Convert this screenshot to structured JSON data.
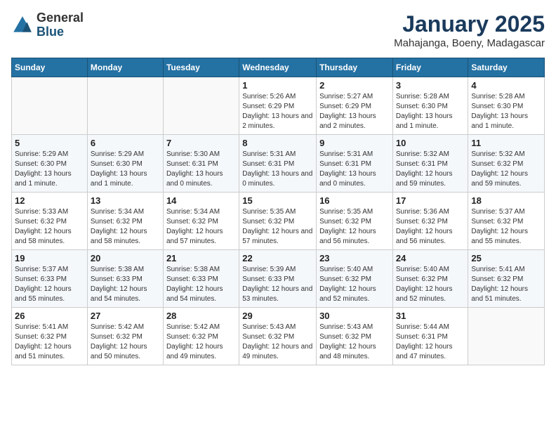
{
  "header": {
    "logo_general": "General",
    "logo_blue": "Blue",
    "title": "January 2025",
    "subtitle": "Mahajanga, Boeny, Madagascar"
  },
  "weekdays": [
    "Sunday",
    "Monday",
    "Tuesday",
    "Wednesday",
    "Thursday",
    "Friday",
    "Saturday"
  ],
  "weeks": [
    [
      {
        "day": "",
        "info": ""
      },
      {
        "day": "",
        "info": ""
      },
      {
        "day": "",
        "info": ""
      },
      {
        "day": "1",
        "info": "Sunrise: 5:26 AM\nSunset: 6:29 PM\nDaylight: 13 hours and 2 minutes."
      },
      {
        "day": "2",
        "info": "Sunrise: 5:27 AM\nSunset: 6:29 PM\nDaylight: 13 hours and 2 minutes."
      },
      {
        "day": "3",
        "info": "Sunrise: 5:28 AM\nSunset: 6:30 PM\nDaylight: 13 hours and 1 minute."
      },
      {
        "day": "4",
        "info": "Sunrise: 5:28 AM\nSunset: 6:30 PM\nDaylight: 13 hours and 1 minute."
      }
    ],
    [
      {
        "day": "5",
        "info": "Sunrise: 5:29 AM\nSunset: 6:30 PM\nDaylight: 13 hours and 1 minute."
      },
      {
        "day": "6",
        "info": "Sunrise: 5:29 AM\nSunset: 6:30 PM\nDaylight: 13 hours and 1 minute."
      },
      {
        "day": "7",
        "info": "Sunrise: 5:30 AM\nSunset: 6:31 PM\nDaylight: 13 hours and 0 minutes."
      },
      {
        "day": "8",
        "info": "Sunrise: 5:31 AM\nSunset: 6:31 PM\nDaylight: 13 hours and 0 minutes."
      },
      {
        "day": "9",
        "info": "Sunrise: 5:31 AM\nSunset: 6:31 PM\nDaylight: 13 hours and 0 minutes."
      },
      {
        "day": "10",
        "info": "Sunrise: 5:32 AM\nSunset: 6:31 PM\nDaylight: 12 hours and 59 minutes."
      },
      {
        "day": "11",
        "info": "Sunrise: 5:32 AM\nSunset: 6:32 PM\nDaylight: 12 hours and 59 minutes."
      }
    ],
    [
      {
        "day": "12",
        "info": "Sunrise: 5:33 AM\nSunset: 6:32 PM\nDaylight: 12 hours and 58 minutes."
      },
      {
        "day": "13",
        "info": "Sunrise: 5:34 AM\nSunset: 6:32 PM\nDaylight: 12 hours and 58 minutes."
      },
      {
        "day": "14",
        "info": "Sunrise: 5:34 AM\nSunset: 6:32 PM\nDaylight: 12 hours and 57 minutes."
      },
      {
        "day": "15",
        "info": "Sunrise: 5:35 AM\nSunset: 6:32 PM\nDaylight: 12 hours and 57 minutes."
      },
      {
        "day": "16",
        "info": "Sunrise: 5:35 AM\nSunset: 6:32 PM\nDaylight: 12 hours and 56 minutes."
      },
      {
        "day": "17",
        "info": "Sunrise: 5:36 AM\nSunset: 6:32 PM\nDaylight: 12 hours and 56 minutes."
      },
      {
        "day": "18",
        "info": "Sunrise: 5:37 AM\nSunset: 6:32 PM\nDaylight: 12 hours and 55 minutes."
      }
    ],
    [
      {
        "day": "19",
        "info": "Sunrise: 5:37 AM\nSunset: 6:33 PM\nDaylight: 12 hours and 55 minutes."
      },
      {
        "day": "20",
        "info": "Sunrise: 5:38 AM\nSunset: 6:33 PM\nDaylight: 12 hours and 54 minutes."
      },
      {
        "day": "21",
        "info": "Sunrise: 5:38 AM\nSunset: 6:33 PM\nDaylight: 12 hours and 54 minutes."
      },
      {
        "day": "22",
        "info": "Sunrise: 5:39 AM\nSunset: 6:33 PM\nDaylight: 12 hours and 53 minutes."
      },
      {
        "day": "23",
        "info": "Sunrise: 5:40 AM\nSunset: 6:32 PM\nDaylight: 12 hours and 52 minutes."
      },
      {
        "day": "24",
        "info": "Sunrise: 5:40 AM\nSunset: 6:32 PM\nDaylight: 12 hours and 52 minutes."
      },
      {
        "day": "25",
        "info": "Sunrise: 5:41 AM\nSunset: 6:32 PM\nDaylight: 12 hours and 51 minutes."
      }
    ],
    [
      {
        "day": "26",
        "info": "Sunrise: 5:41 AM\nSunset: 6:32 PM\nDaylight: 12 hours and 51 minutes."
      },
      {
        "day": "27",
        "info": "Sunrise: 5:42 AM\nSunset: 6:32 PM\nDaylight: 12 hours and 50 minutes."
      },
      {
        "day": "28",
        "info": "Sunrise: 5:42 AM\nSunset: 6:32 PM\nDaylight: 12 hours and 49 minutes."
      },
      {
        "day": "29",
        "info": "Sunrise: 5:43 AM\nSunset: 6:32 PM\nDaylight: 12 hours and 49 minutes."
      },
      {
        "day": "30",
        "info": "Sunrise: 5:43 AM\nSunset: 6:32 PM\nDaylight: 12 hours and 48 minutes."
      },
      {
        "day": "31",
        "info": "Sunrise: 5:44 AM\nSunset: 6:31 PM\nDaylight: 12 hours and 47 minutes."
      },
      {
        "day": "",
        "info": ""
      }
    ]
  ]
}
